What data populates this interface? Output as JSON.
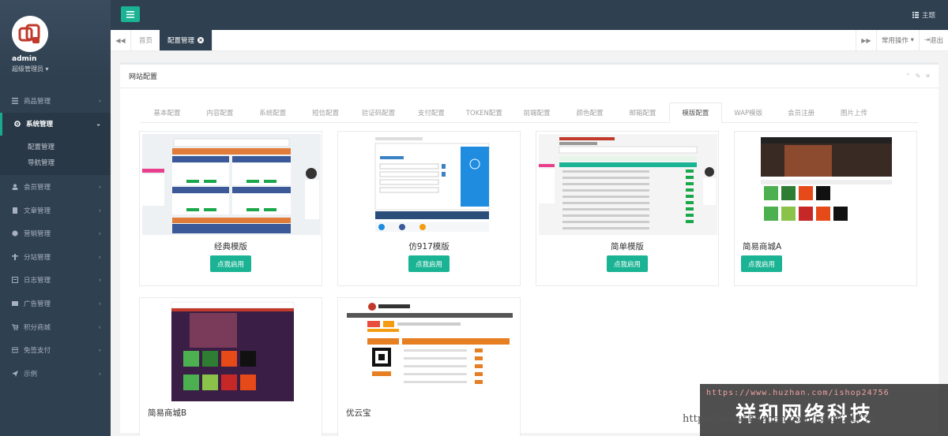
{
  "user": {
    "name": "admin",
    "role": "超级管理员"
  },
  "sidebar": {
    "items": [
      {
        "label": "商品管理",
        "icon": "list-icon"
      },
      {
        "label": "系统管理",
        "icon": "gear-icon"
      },
      {
        "label": "会员管理",
        "icon": "users-icon"
      },
      {
        "label": "文章管理",
        "icon": "file-icon"
      },
      {
        "label": "营销管理",
        "icon": "pie-icon"
      },
      {
        "label": "分站管理",
        "icon": "sitemap-icon"
      },
      {
        "label": "日志管理",
        "icon": "log-icon"
      },
      {
        "label": "广告管理",
        "icon": "image-icon"
      },
      {
        "label": "积分商城",
        "icon": "cart-icon"
      },
      {
        "label": "免签支付",
        "icon": "card-icon"
      },
      {
        "label": "示例",
        "icon": "send-icon"
      }
    ],
    "sub": [
      "配置管理",
      "导航管理"
    ]
  },
  "top": {
    "theme": "主题"
  },
  "pagetabs": {
    "home": "首页",
    "current": "配置管理"
  },
  "ops": {
    "common": "常用操作",
    "exit": "退出"
  },
  "panel": {
    "title": "网站配置"
  },
  "ctabs": [
    "基本配置",
    "内容配置",
    "系统配置",
    "短信配置",
    "验证码配置",
    "支付配置",
    "TOKEN配置",
    "前端配置",
    "颜色配置",
    "邮箱配置",
    "模版配置",
    "WAP模版",
    "会员注册",
    "图片上传"
  ],
  "templates": [
    {
      "name": "经典模版",
      "button": "点我启用"
    },
    {
      "name": "仿917模版",
      "button": "点我启用"
    },
    {
      "name": "简单模版",
      "button": "点我启用"
    },
    {
      "name": "简易商城A",
      "button": "点我启用"
    },
    {
      "name": "简易商城B",
      "button": ""
    },
    {
      "name": "优云宝",
      "button": ""
    }
  ],
  "watermark": {
    "url": "https://www.huzhan.com/ishop24756",
    "text": "祥和网络科技",
    "url2": "https://www.huzhan.com/ishop24756"
  },
  "colors": {
    "accent": "#1ab394",
    "nav": "#2f4050"
  }
}
